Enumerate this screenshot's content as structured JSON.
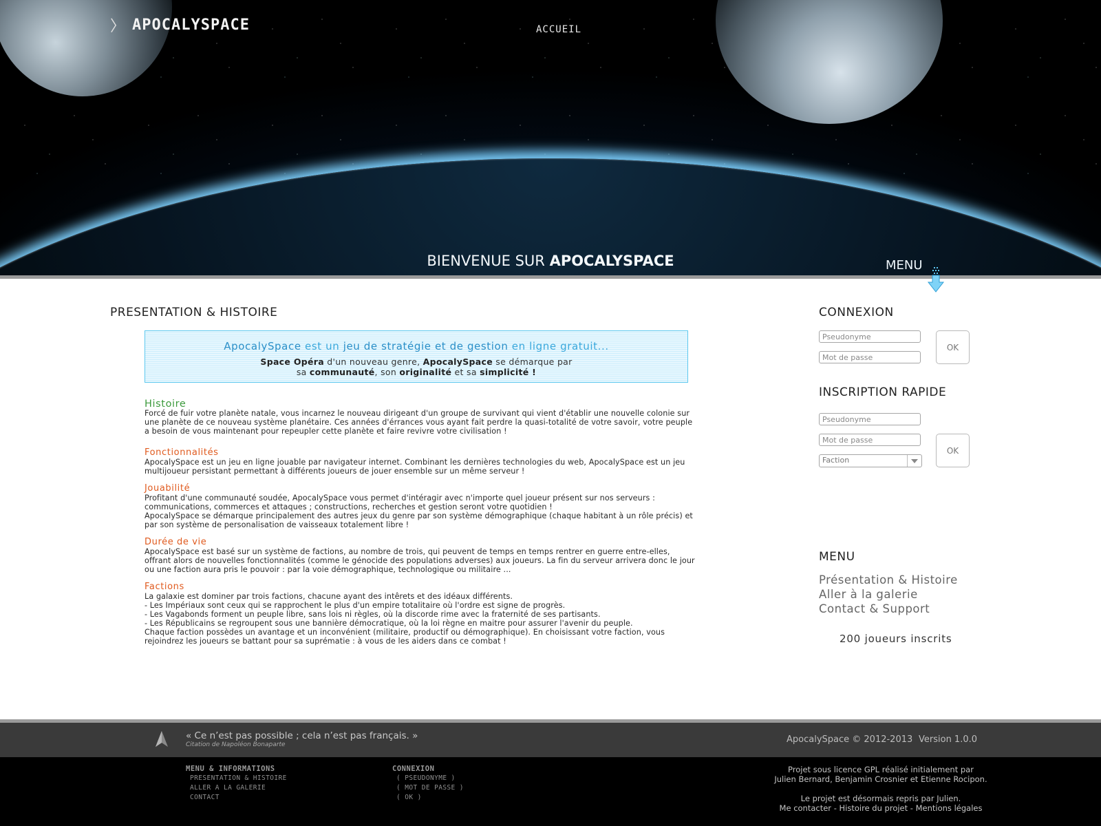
{
  "header": {
    "logo_text": "APOCALYSPACE",
    "logo_chevron": "〉",
    "nav_home": "ACCUEIL",
    "welcome_prefix": "BIENVENUE SUR ",
    "welcome_brand": "APOCALYSPACE",
    "menu_label": "MENU",
    "menu_icon": "down-arrow-icon"
  },
  "main": {
    "title": "PRESENTATION & HISTOIRE",
    "intro": {
      "l1_a": "ApocalySpace",
      "l1_b": " est un ",
      "l1_c": "jeu de stratégie et de gestion",
      "l1_d": " en ligne gratuit...",
      "l2_a": "Space Opéra",
      "l2_b": " d'un nouveau genre, ",
      "l2_c": "ApocalySpace",
      "l2_d": " se démarque par",
      "l3_a": "sa ",
      "l3_b": "communauté",
      "l3_c": ", son ",
      "l3_d": "originalité",
      "l3_e": " et sa ",
      "l3_f": "simplicité !"
    },
    "articles": [
      {
        "title": "Histoire",
        "text": "Forcé de fuir votre planète natale, vous incarnez le nouveau dirigeant d'un groupe de survivant qui vient d'établir une nouvelle colonie sur une planète de ce nouveau système planétaire. Ces années d'érrances vous ayant fait perdre la quasi-totalité de votre savoir, votre peuple a besoin de vous maintenant pour repeupler cette planète et faire revivre votre civilisation !"
      },
      {
        "title": "Fonctionnalités",
        "text": "ApocalySpace est un jeu en ligne jouable par navigateur internet. Combinant les dernières technologies du web, ApocalySpace est un jeu multijoueur persistant permettant à différents joueurs de jouer ensemble sur un même serveur !"
      },
      {
        "title": "Jouabilité",
        "text": "Profitant d'une communauté soudée, ApocalySpace vous permet d'intéragir avec n'importe quel joueur présent sur nos serveurs : communications, commerces et attaques ; constructions, recherches et gestion seront votre quotidien !",
        "text2": "ApocalySpace se démarque principalement des autres jeux du genre par son système démographique (chaque habitant à un rôle précis) et par son système de personalisation de vaisseaux totalement libre !"
      },
      {
        "title": "Durée de vie",
        "text": "ApocalySpace est basé sur un système de factions, au nombre de trois, qui peuvent de temps en temps rentrer en guerre entre-elles, offrant alors de nouvelles fonctionnalités (comme le génocide des populations adverses) aux joueurs. La fin du serveur arrivera donc le jour ou une faction aura pris le pouvoir : par la voie démographique, technologique ou militaire ..."
      },
      {
        "title": "Factions",
        "text": "La galaxie est dominer par trois factions, chacune ayant des intêrets et des idéaux différents.",
        "line1": "- Les Impériaux sont ceux qui se rapprochent le plus d'un empire totalitaire où l'ordre est signe de progrès.",
        "line2": "- Les Vagabonds forment un peuple libre, sans lois ni règles, où la discorde rime avec la fraternité de ses partisants.",
        "line3": "- Les Républicains se regroupent sous une bannière démocratique, où la loi règne en maitre pour assurer l'avenir du peuple.",
        "text2": "Chaque faction possèdes un avantage et un inconvénient (militaire, productif ou démographique). En choisissant votre faction, vous rejoindrez les joueurs se battant pour sa suprématie : à vous de les aiders dans ce combat !"
      }
    ]
  },
  "sidebar": {
    "login": {
      "title": "CONNEXION",
      "user_placeholder": "Pseudonyme",
      "pass_placeholder": "Mot de passe",
      "ok": "OK"
    },
    "signup": {
      "title": "INSCRIPTION RAPIDE",
      "user_placeholder": "Pseudonyme",
      "pass_placeholder": "Mot de passe",
      "faction_value": "Faction",
      "ok": "OK"
    },
    "menu": {
      "title": "MENU",
      "items": [
        "Présentation & Histoire",
        "Aller à la galerie",
        "Contact & Support"
      ]
    },
    "players": "200 joueurs inscrits"
  },
  "footer": {
    "quote": "« Ce n’est pas possible ; cela n’est pas français. »",
    "quote_source": "Citation de Napoléon Bonaparte",
    "quote_icon": "cursor-arrow-icon",
    "copyright": "ApocalySpace © 2012-2013",
    "version": "Version 1.0.0",
    "col1": {
      "title": "MENU & INFORMATIONS",
      "links": [
        "PRESENTATION & HISTOIRE",
        "ALLER A LA GALERIE",
        "CONTACT"
      ]
    },
    "col2": {
      "title": "CONNEXION",
      "links": [
        "( PSEUDONYME )",
        "( MOT DE PASSE )",
        "( OK )"
      ]
    },
    "credits": {
      "l1": "Projet sous licence GPL réalisé initialement par",
      "l2": "Julien Bernard, Benjamin Crosnier et Etienne Rocipon.",
      "l3": "Le projet est désormais repris par Julien.",
      "link_contact": "Me contacter",
      "sep": " - ",
      "link_history": "Histoire du projet",
      "link_legal": "Mentions légales"
    }
  }
}
